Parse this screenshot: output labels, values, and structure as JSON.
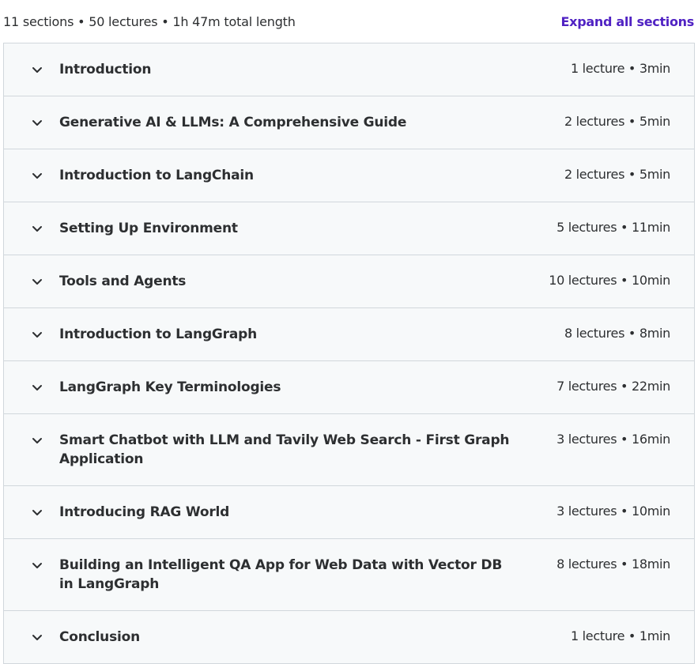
{
  "summary": {
    "text": "11 sections • 50 lectures • 1h 47m total length",
    "expand_label": "Expand all sections"
  },
  "icons": {
    "section_toggle": "chevron-down-icon"
  },
  "colors": {
    "accent": "#5022c3",
    "section_bg": "#f7f9fa",
    "border": "#d1d7dc",
    "text": "#2d2f31"
  },
  "sections": [
    {
      "title": "Introduction",
      "meta": "1 lecture • 3min"
    },
    {
      "title": "Generative AI & LLMs: A Comprehensive Guide",
      "meta": "2 lectures • 5min"
    },
    {
      "title": "Introduction to LangChain",
      "meta": "2 lectures • 5min"
    },
    {
      "title": "Setting Up Environment",
      "meta": "5 lectures • 11min"
    },
    {
      "title": "Tools and Agents",
      "meta": "10 lectures • 10min"
    },
    {
      "title": "Introduction to LangGraph",
      "meta": "8 lectures • 8min"
    },
    {
      "title": "LangGraph Key Terminologies",
      "meta": "7 lectures • 22min"
    },
    {
      "title": "Smart Chatbot with LLM and Tavily Web Search - First Graph Application",
      "meta": "3 lectures • 16min"
    },
    {
      "title": "Introducing RAG World",
      "meta": "3 lectures • 10min"
    },
    {
      "title": "Building an Intelligent QA App for Web Data with Vector DB in LangGraph",
      "meta": "8 lectures • 18min"
    },
    {
      "title": "Conclusion",
      "meta": "1 lecture • 1min"
    }
  ]
}
